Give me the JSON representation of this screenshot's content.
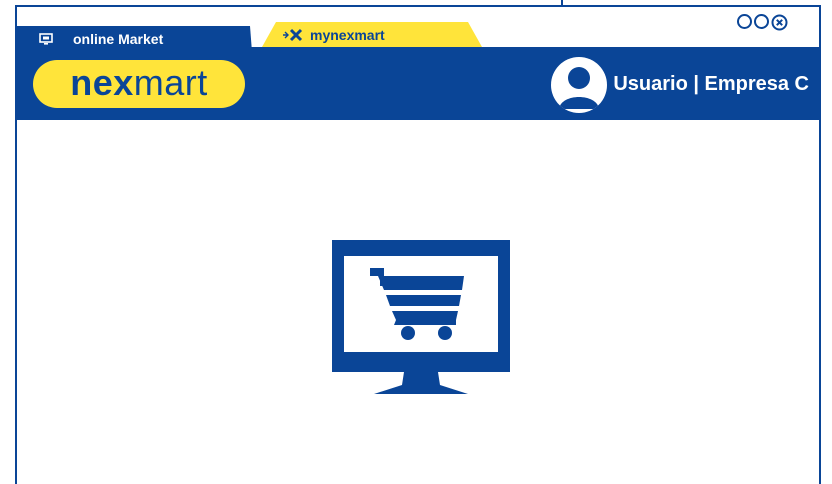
{
  "tabs": {
    "online_market": {
      "label": "online Market",
      "icon": "monitor-icon"
    },
    "mynexmart": {
      "label": "mynexmart",
      "icon": "nexmart-x-icon"
    }
  },
  "window_controls": [
    "minimize-circle",
    "maximize-circle",
    "close-circle"
  ],
  "header": {
    "logo": {
      "bold_part": "nex",
      "light_part": "mart"
    },
    "user": {
      "label": "Usuario | Empresa C",
      "icon": "user-avatar-icon"
    }
  },
  "main": {
    "illustration": "monitor-shopping-cart-icon"
  },
  "colors": {
    "primary": "#0a4597",
    "accent": "#ffe43a",
    "background": "#ffffff"
  }
}
